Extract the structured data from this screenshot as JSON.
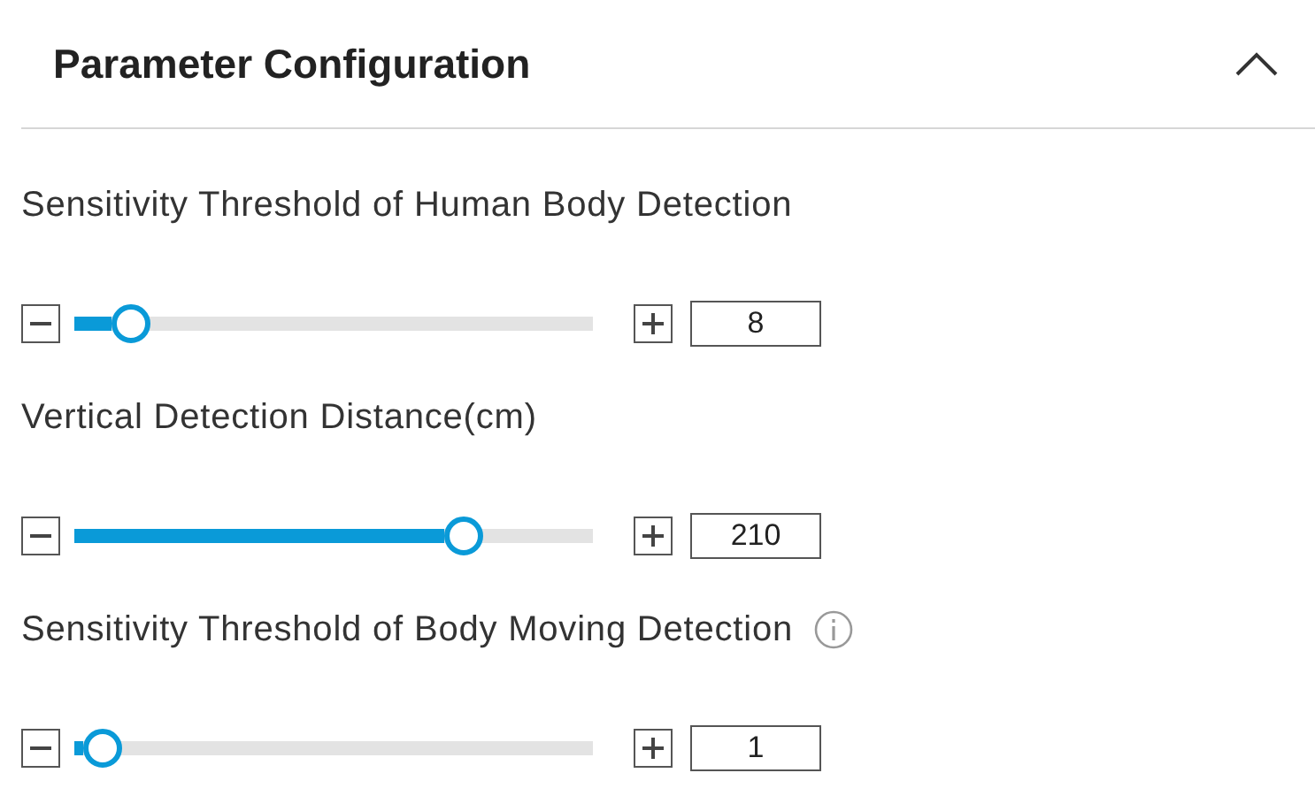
{
  "panel": {
    "title": "Parameter Configuration",
    "expanded": true
  },
  "parameters": [
    {
      "label": "Sensitivity Threshold of Human Body Detection",
      "info": false,
      "level": 0.11,
      "value": "8"
    },
    {
      "label": "Vertical Detection Distance(cm)",
      "info": false,
      "level": 0.75,
      "value": "210"
    },
    {
      "label": "Sensitivity Threshold of Body Moving Detection",
      "info": true,
      "level": 0.055,
      "value": "1"
    }
  ]
}
